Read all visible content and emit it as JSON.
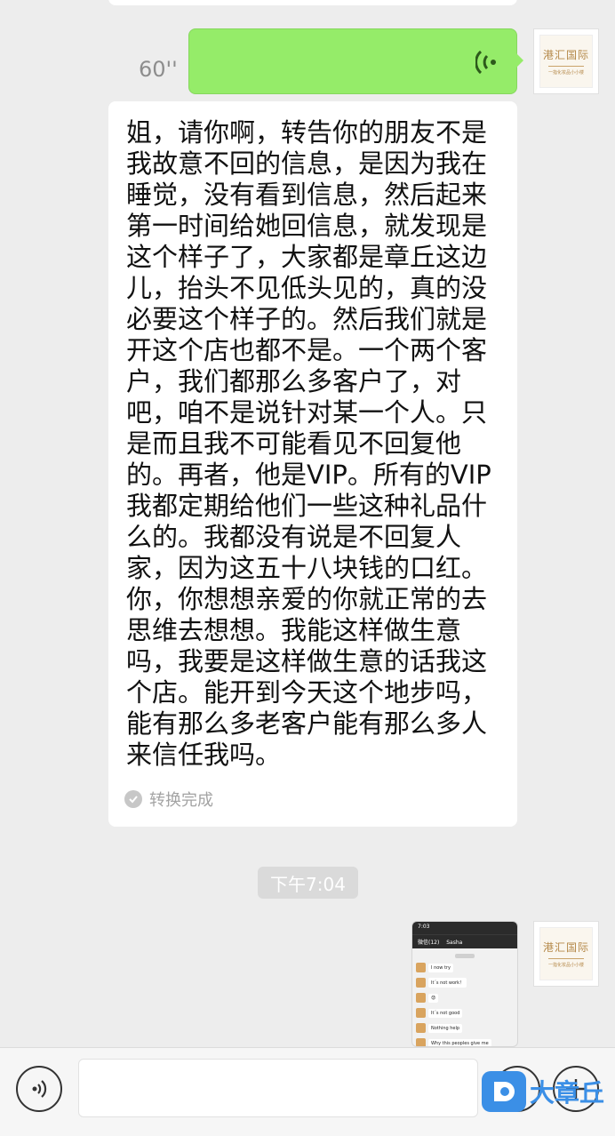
{
  "voice_message": {
    "duration": "60''"
  },
  "transcript": {
    "text": "姐，请你啊，转告你的朋友不是我故意不回的信息，是因为我在睡觉，没有看到信息，然后起来第一时间给她回信息，就发现是这个样子了，大家都是章丘这边儿，抬头不见低头见的，真的没必要这个样子的。然后我们就是开这个店也都不是。一个两个客户，我们都那么多客户了，对吧，咱不是说针对某一个人。只是而且我不可能看见不回复他的。再者，他是VIP。所有的VIP我都定期给他们一些这种礼品什么的。我都没有说是不回复人家，因为这五十八块钱的口红。你，你想想亲爱的你就正常的去思维去想想。我能这样做生意吗，我要是这样做生意的话我这个店。能开到今天这个地步吗，能有那么多老客户能有那么多人来信任我吗。",
    "status": "转换完成"
  },
  "timestamp": "下午7:04",
  "avatar": {
    "brand": "港汇国际",
    "tagline": "一指化妆品小小楼"
  },
  "thumbnail": {
    "status_time": "7:03",
    "nav_title": "Sasha",
    "nav_back": "微信(12)",
    "messages": [
      "I now try",
      "It´s not work！",
      "😟",
      "It´s not good",
      "Nothing help",
      "Why this peoples give me"
    ]
  },
  "watermark": {
    "text": "大章丘"
  },
  "colors": {
    "voice_bubble": "#95ec69",
    "background": "#ededed",
    "watermark": "#3b8fe6"
  },
  "icons": [
    "voice-wave-icon",
    "check-circle-icon",
    "voice-input-icon",
    "emoji-icon",
    "plus-icon"
  ]
}
